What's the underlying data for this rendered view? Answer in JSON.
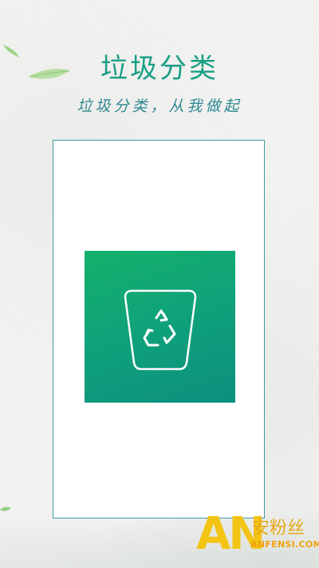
{
  "header": {
    "title": "垃圾分类",
    "subtitle": "垃圾分类，从我做起"
  },
  "app_icon": {
    "icon": "recycle-bin-icon",
    "gradient_colors": [
      "#14b06a",
      "#0c8f7e"
    ]
  },
  "watermark": {
    "logo": "AN",
    "text": "安粉丝",
    "domain": "ANFENSI.COM"
  },
  "colors": {
    "title": "#189e85",
    "subtitle": "#2f8a93",
    "frame_border": "#3e9aa0",
    "watermark_yellow": "#f3c414"
  }
}
